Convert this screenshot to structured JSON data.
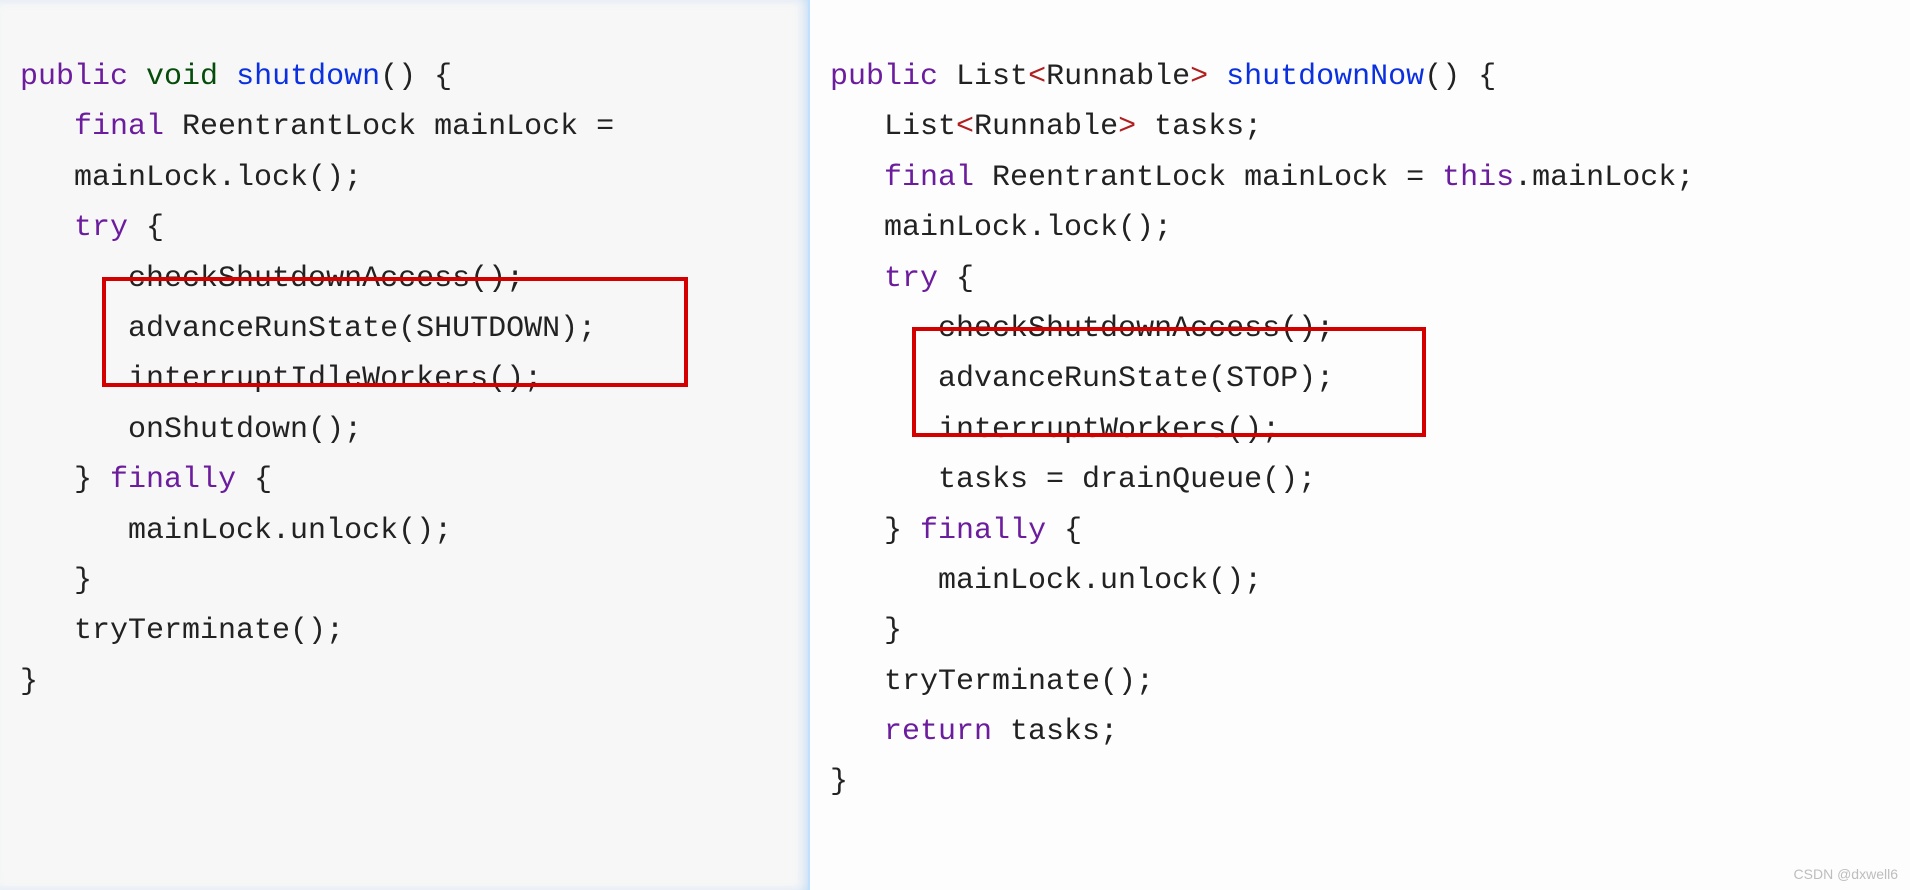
{
  "left": {
    "tokens": {
      "kw_public": "public",
      "kw_void": "void",
      "fn_name": "shutdown",
      "paren_brace": "() {",
      "kw_final": "final",
      "type_lock": "ReentrantLock",
      "var_main": "mainLock =",
      "lock_call": "mainLock.lock();",
      "kw_try": "try",
      "brace_open": " {",
      "chk": "checkShutdownAccess();",
      "adv": "advanceRunState(SHUTDOWN);",
      "intw": "interruptIdleWorkers();",
      "onsd": "onShutdown();",
      "brace_close": "}",
      "kw_finally": "finally",
      "unlock": "mainLock.unlock();",
      "tryterm": "tryTerminate();"
    }
  },
  "right": {
    "tokens": {
      "kw_public": "public",
      "type_list": "List",
      "lt": "<",
      "type_runnable": "Runnable",
      "gt": ">",
      "fn_name": "shutdownNow",
      "paren_brace": "() {",
      "decl_tasks": "tasks;",
      "kw_final": "final",
      "type_lock": "ReentrantLock",
      "var_main": "mainLock = ",
      "kw_this": "this",
      "dot_main": ".mainLock;",
      "lock_call": "mainLock.lock();",
      "kw_try": "try",
      "brace_open": " {",
      "chk": "checkShutdownAccess();",
      "adv": "advanceRunState(STOP);",
      "intw": "interruptWorkers();",
      "drain": "tasks = drainQueue();",
      "brace_close": "}",
      "kw_finally": "finally",
      "unlock": "mainLock.unlock();",
      "tryterm": "tryTerminate();",
      "kw_return": "return",
      "ret_tasks": " tasks;"
    }
  },
  "watermark": "CSDN @dxwell6"
}
